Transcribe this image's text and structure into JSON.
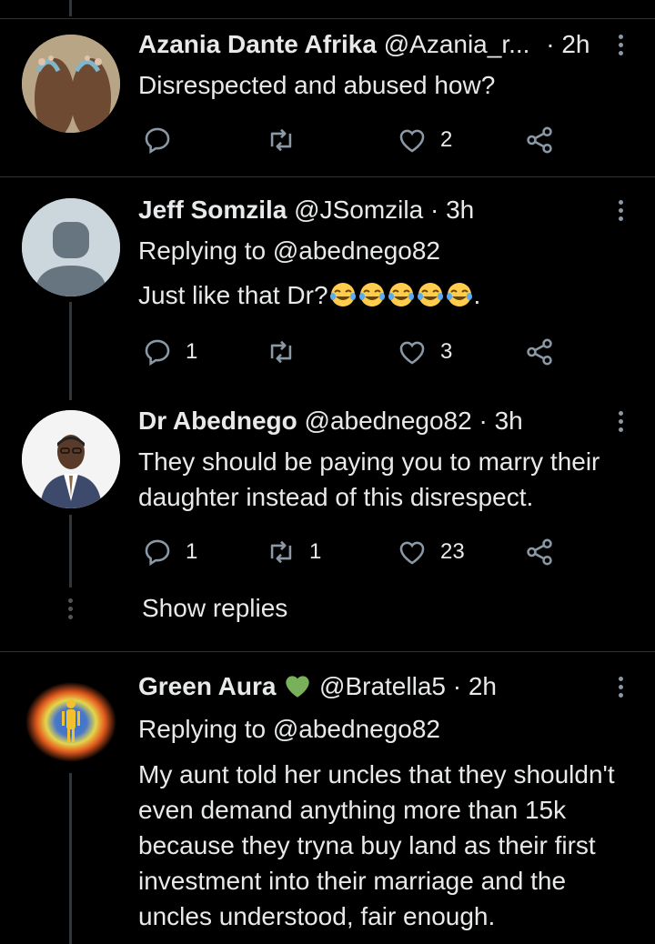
{
  "tweets": [
    {
      "name": "Azania Dante Afrika",
      "handle": "@Azania_r...",
      "time": "· 2h",
      "text": "Disrespected and abused how?",
      "counts": {
        "reply": "",
        "retweet": "",
        "like": "2"
      }
    },
    {
      "name": "Jeff Somzila",
      "handle": "@JSomzila",
      "time": "· 3h",
      "replying": "Replying to @abednego82",
      "text": "Just like that Dr?",
      "text_suffix": ".",
      "counts": {
        "reply": "1",
        "retweet": "",
        "like": "3"
      }
    },
    {
      "name": "Dr Abednego",
      "handle": "@abednego82",
      "time": "· 3h",
      "text": "They should be paying you to marry their daughter instead of this disrespect.",
      "counts": {
        "reply": "1",
        "retweet": "1",
        "like": "23"
      }
    },
    {
      "name": "Green Aura",
      "handle": "@Bratella5",
      "time": "· 2h",
      "replying": "Replying to @abednego82",
      "text": "My aunt told her uncles that they shouldn't even demand anything more than 15k because they tryna buy land as their first investment into their marriage and the uncles understood, fair enough.",
      "counts": {
        "reply": "",
        "retweet": "",
        "like": ""
      }
    }
  ],
  "show_replies": "Show replies",
  "icons": [
    "reply-icon",
    "retweet-icon",
    "like-icon",
    "share-icon",
    "more-options-icon",
    "green-heart-emoji",
    "laughing-crying-emoji"
  ],
  "colors": {
    "background": "#000000",
    "text": "#e7e9ea",
    "icon": "#8b98a5",
    "divider": "#2f3336",
    "green_heart": "#78b159"
  }
}
